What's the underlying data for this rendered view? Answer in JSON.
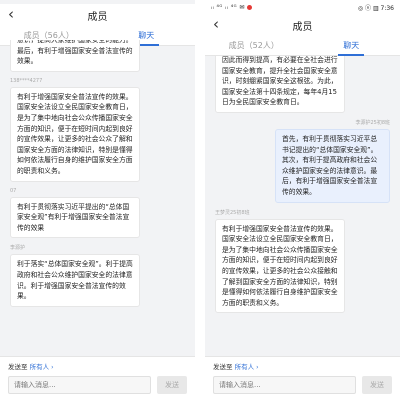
{
  "left": {
    "title": "成员",
    "tabs": [
      "成员（56人）",
      "聊天"
    ],
    "messages": [
      {
        "sender": "",
        "mine": false,
        "text": "意识，提高大家维护国家安全的能力。最后，有利于增强国家安全普法宣传的效果。"
      },
      {
        "sender": "138****4277",
        "mine": false,
        "text": "有利于增强国家安全普法宣传的效果。国家安全法设立全民国家安全教育日，是为了集中地向社会公众传播国家安全方面的知识，便于在短时间内起到良好的宣传效果，让更多的社会公众了解和国家安全方面的法律知识，特别是懂得如何依法履行自身的维护国家安全方面的职责和义务。"
      },
      {
        "sender": "07",
        "mine": false,
        "text": "有利于贯彻落实习近平提出的“总体国家安全观”有利于增强国家安全普法宣传的效果"
      },
      {
        "sender": "李源护",
        "mine": false,
        "text": "利于落实“总体国家安全观”。利于提高政府和社会公众维护国家安全的法律意识。利于增强国家安全普法宣传的效果。"
      }
    ],
    "send_to_label": "发送至",
    "send_to_value": "所有人",
    "input_placeholder": "请输入消息...",
    "send_button": "发送"
  },
  "right": {
    "status_left": "ᵢₗ ⁴ᴳ ᵢₗ ⁴ᴳ ✉",
    "status_right": "◎ ⓝ ▥ 7:36",
    "title": "成员",
    "tabs": [
      "成员（52人）",
      "聊天"
    ],
    "messages": [
      {
        "sender": "",
        "mine": false,
        "text": "因此而得到提高，有必要在全社会进行国家安全教育，提升全社会国家安全意识，时刻绷紧国家安全这根弦。为此，国家安全法第十四条规定，每年4月15日为全民国家安全教育日。"
      },
      {
        "sender": "李源护25初8班",
        "mine": true,
        "text": "首先，有利于贯彻落实习近平总书记提出的“总体国家安全观”。其次，有利于提高政府和社会公众维护国家安全的法律意识。最后，有利于增强国家安全普法宣传的效果。"
      },
      {
        "sender": "王梦灵25初8班",
        "mine": false,
        "text": "有利于增强国家安全普法宣传的效果。国家安全法设立全民国家安全教育日，是为了集中地向社会公众传播国家安全方面的知识，便于在短时间内起到良好的宣传效果，让更多的社会公众接触和了解到国家安全方面的法律知识，特别是懂得如何依法履行自身维护国家安全方面的职责和义务。"
      }
    ],
    "send_to_label": "发送至",
    "send_to_value": "所有人",
    "input_placeholder": "请输入消息...",
    "send_button": "发送"
  }
}
